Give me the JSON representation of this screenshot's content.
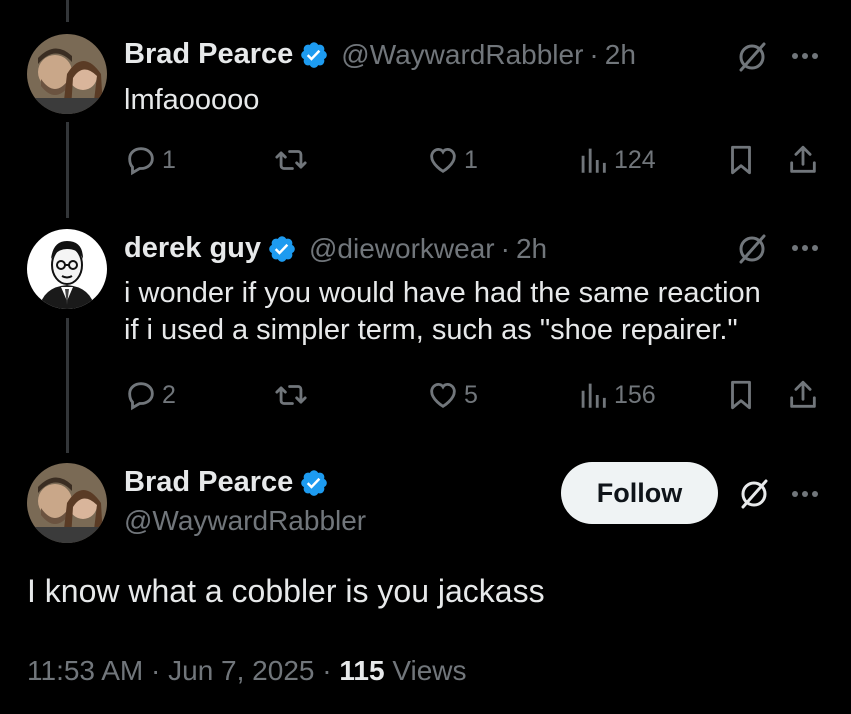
{
  "tweets": [
    {
      "name": "Brad Pearce",
      "handle": "@WaywardRabbler",
      "dot": "·",
      "time": "2h",
      "text": "lmfaooooo",
      "replies": "1",
      "retweets": "",
      "likes": "1",
      "views": "124"
    },
    {
      "name": "derek guy",
      "handle": "@dieworkwear",
      "dot": "·",
      "time": "2h",
      "text_line1": "i wonder if you would have had the same reaction",
      "text_line2": "if i used a simpler term, such as \"shoe repairer.\"",
      "replies": "2",
      "retweets": "",
      "likes": "5",
      "views": "156"
    }
  ],
  "main_tweet": {
    "name": "Brad Pearce",
    "handle": "@WaywardRabbler",
    "follow_label": "Follow",
    "text": "I know what a cobbler is you jackass",
    "time": "11:53 AM",
    "dot1": "·",
    "date": "Jun 7, 2025",
    "dot2": "·",
    "views_count": "115",
    "views_label": "Views"
  },
  "icons": {
    "verified": "verified-badge-icon",
    "grok": "grok-icon",
    "more": "more-icon",
    "reply": "reply-icon",
    "retweet": "retweet-icon",
    "like": "like-icon",
    "views": "views-icon",
    "bookmark": "bookmark-icon",
    "share": "share-icon"
  },
  "colors": {
    "background": "#000000",
    "text": "#e7e9ea",
    "muted": "#71767b",
    "verified": "#1d9bf0",
    "thread_line": "#333639",
    "follow_bg": "#eff3f4"
  }
}
